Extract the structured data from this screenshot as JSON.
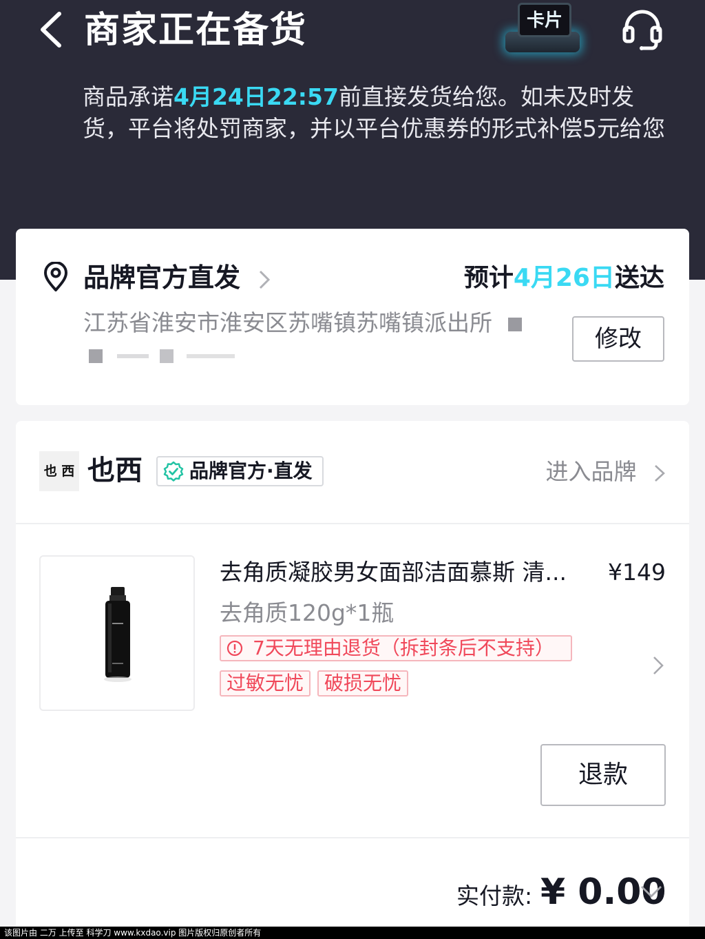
{
  "header": {
    "title": "商家正在备货",
    "card_label": "卡片",
    "promise_prefix": "商品承诺",
    "promise_deadline": "4月24日22:57",
    "promise_suffix": "前直接发货给您。如未及时发货，平台将处罚商家，并以平台优惠券的形式补偿5元给您",
    "icons": [
      "back-icon",
      "card-icon",
      "headset-icon"
    ]
  },
  "address": {
    "ship_label": "品牌官方直发",
    "eta_prefix": "预计",
    "eta_date": "4月26日",
    "eta_suffix": "送达",
    "address_text": "江苏省淮安市淮安区苏嘴镇苏嘴镇派出所",
    "edit_label": "修改"
  },
  "shop": {
    "logo_text": "也 西",
    "name": "也西",
    "badge": "品牌官方·直发",
    "enter_label": "进入品牌"
  },
  "product": {
    "title": "去角质凝胶男女面部洁面慕斯 清...",
    "price": "¥149",
    "sku": "去角质120g*1瓶",
    "tags": {
      "return_policy": "7天无理由退货（拆封条后不支持）",
      "allergy": "过敏无忧",
      "damage": "破损无忧"
    },
    "refund_label": "退款"
  },
  "payment": {
    "label": "实付款:",
    "amount": "¥ 0.00"
  },
  "watermark": "该图片由 二万 上传至 科学刀 www.kxdao.vip 图片版权归原创者所有",
  "colors": {
    "header_bg": "#2a2a38",
    "accent": "#3ad9f3",
    "tag_red": "#f0485a",
    "badge_green": "#22c3a4"
  }
}
